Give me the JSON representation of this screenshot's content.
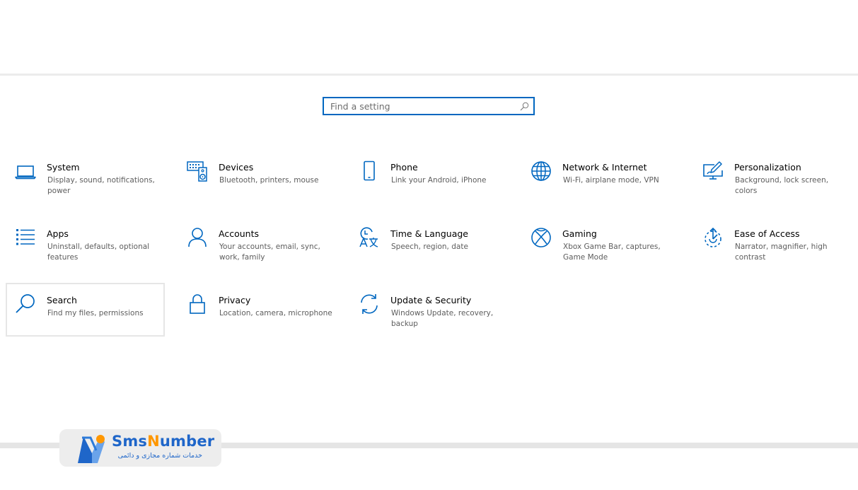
{
  "search": {
    "placeholder": "Find a setting",
    "icon": "search-icon"
  },
  "colors": {
    "accent": "#0067c0",
    "title": "#000000",
    "subtitle": "#5d5d5d",
    "logo_blue": "#1f66c9",
    "logo_orange": "#ff9700"
  },
  "categories": [
    {
      "title": "System",
      "subtitle": "Display, sound, notifications, power",
      "icon": "laptop-icon"
    },
    {
      "title": "Devices",
      "subtitle": "Bluetooth, printers, mouse",
      "icon": "keyboard-speaker-icon"
    },
    {
      "title": "Phone",
      "subtitle": "Link your Android, iPhone",
      "icon": "phone-icon"
    },
    {
      "title": "Network & Internet",
      "subtitle": "Wi-Fi, airplane mode, VPN",
      "icon": "globe-icon"
    },
    {
      "title": "Personalization",
      "subtitle": "Background, lock screen, colors",
      "icon": "pen-screen-icon"
    },
    {
      "title": "Apps",
      "subtitle": "Uninstall, defaults, optional features",
      "icon": "list-icon"
    },
    {
      "title": "Accounts",
      "subtitle": "Your accounts, email, sync, work, family",
      "icon": "person-icon"
    },
    {
      "title": "Time & Language",
      "subtitle": "Speech, region, date",
      "icon": "clock-language-icon"
    },
    {
      "title": "Gaming",
      "subtitle": "Xbox Game Bar, captures, Game Mode",
      "icon": "xbox-icon"
    },
    {
      "title": "Ease of Access",
      "subtitle": "Narrator, magnifier, high contrast",
      "icon": "ease-of-access-icon"
    },
    {
      "title": "Search",
      "subtitle": "Find my files, permissions",
      "icon": "magnifier-icon"
    },
    {
      "title": "Privacy",
      "subtitle": "Location, camera, microphone",
      "icon": "lock-icon"
    },
    {
      "title": "Update & Security",
      "subtitle": "Windows Update, recovery, backup",
      "icon": "sync-arrows-icon"
    }
  ],
  "watermark": {
    "word_a": "Sms",
    "word_b_first": "N",
    "word_b_rest": "umber",
    "tagline": "خدمات شماره مجازی و دائمی",
    "icon": "logo-icon"
  }
}
